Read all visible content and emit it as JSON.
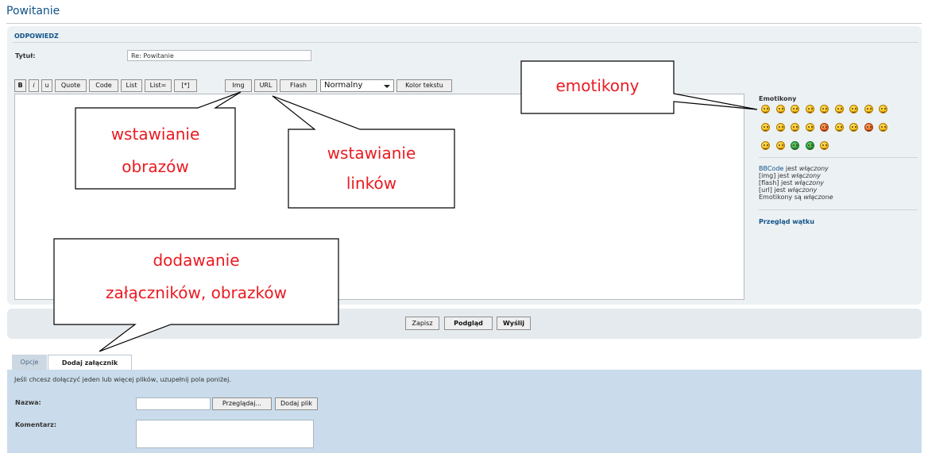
{
  "page": {
    "title": "Powitanie"
  },
  "reply": {
    "heading": "ODPOWIEDZ",
    "title_label": "Tytuł:",
    "title_value": "Re: Powitanie"
  },
  "toolbar": {
    "buttons": [
      "B",
      "i",
      "u",
      "Quote",
      "Code",
      "List",
      "List=",
      "[*]",
      "Img",
      "URL",
      "Flash"
    ],
    "font_size_selected": "Normalny",
    "color_button": "Kolor tekstu"
  },
  "sidebar": {
    "emoticons_heading": "Emotikony",
    "smiley_icons": [
      "smiley-icon",
      "smiley-icon",
      "smiley-icon",
      "smiley-icon",
      "smiley-icon",
      "smiley-icon",
      "smiley-icon",
      "smiley-icon",
      "smiley-icon",
      "smiley-icon",
      "smiley-icon",
      "smiley-icon",
      "smiley-icon",
      "smiley-icon",
      "smiley-icon",
      "smiley-icon",
      "smiley-icon",
      "smiley-icon",
      "smiley-icon",
      "smiley-icon",
      "smiley-icon",
      "smiley-icon",
      "smiley-icon"
    ],
    "status": [
      {
        "key": "BBCode",
        "middle": " jest ",
        "state": "włączony"
      },
      {
        "key": "[img]",
        "middle": " jest ",
        "state": "włączony"
      },
      {
        "key": "[flash]",
        "middle": " jest ",
        "state": "włączony"
      },
      {
        "key": "[url]",
        "middle": " jest ",
        "state": "włączony"
      },
      {
        "key": "Emotikony",
        "middle": " są ",
        "state": "włączone"
      }
    ],
    "review_link": "Przegląd wątku"
  },
  "actions": {
    "save": "Zapisz",
    "preview": "Podgląd",
    "submit": "Wyślij"
  },
  "tabs": {
    "options": "Opcje",
    "attachments": "Dodaj załącznik"
  },
  "attachments": {
    "intro": "Jeśli chcesz dołączyć jeden lub więcej plików, uzupełnij pola poniżej.",
    "name_label": "Nazwa:",
    "browse_button": "Przeglądaj...",
    "add_file_button": "Dodaj plik",
    "comment_label": "Komentarz:"
  },
  "callouts": {
    "emoticons": "emotikony",
    "images_line1": "wstawianie",
    "images_line2": "obrazów",
    "links_line1": "wstawianie",
    "links_line2": "linków",
    "attachments_line1": "dodawanie",
    "attachments_line2": "załączników, obrazków"
  },
  "colors": {
    "link": "#105289",
    "callout_text": "#ea1b22",
    "panel": "#ecf1f3",
    "attachment_panel": "#cadceb"
  }
}
